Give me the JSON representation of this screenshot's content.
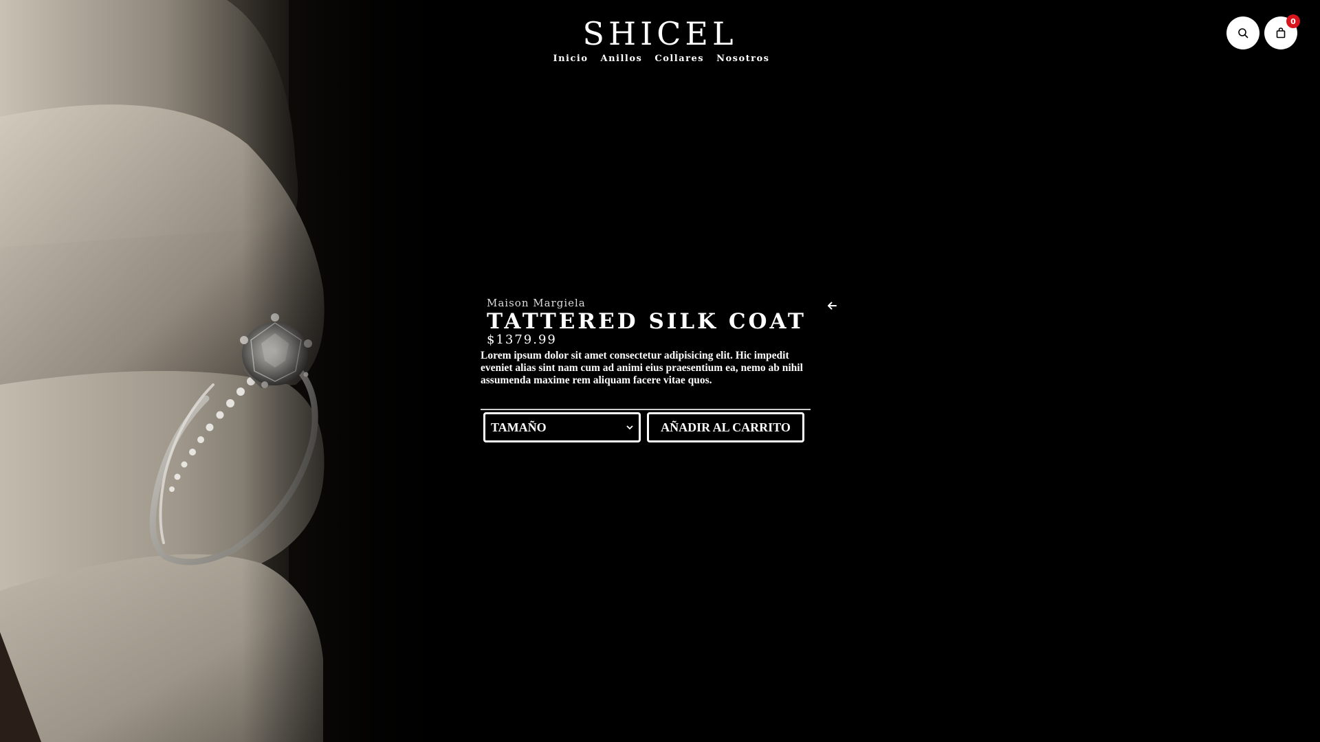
{
  "header": {
    "brand": "SHICEL",
    "nav": [
      "Inicio",
      "Anillos",
      "Collares",
      "Nosotros"
    ],
    "search_icon": "search-icon",
    "cart_icon": "shopping-bag-icon",
    "cart_count": "0",
    "badge_color": "#d8141d"
  },
  "hero": {
    "image": "diamond-ring-in-box"
  },
  "product": {
    "brand": "Maison Margiela",
    "title": "TATTERED SILK COAT",
    "price": "$1379.99",
    "description": "Lorem ipsum dolor sit amet consectetur adipisicing elit. Hic impedit eveniet alias sint nam cum ad animi eius praesentium ea, nemo ab nihil assumenda maxime rem aliquam facere vitae quos.",
    "size_select": {
      "selected": "TAMAÑO"
    },
    "add_to_cart_label": "AÑADIR AL CARRITO",
    "back_icon": "arrow-left-icon"
  }
}
